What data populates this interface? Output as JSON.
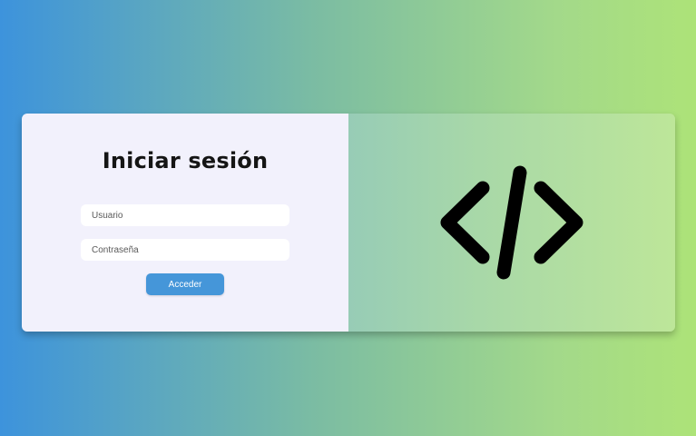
{
  "login": {
    "title": "Iniciar sesión",
    "username_placeholder": "Usuario",
    "password_placeholder": "Contraseña",
    "submit_label": "Acceder"
  },
  "illustration": {
    "icon": "code-icon"
  },
  "colors": {
    "form_background": "#f2f1fc",
    "button": "#4596d9",
    "page_gradient_start": "#3d93dc",
    "page_gradient_end": "#ade378"
  }
}
